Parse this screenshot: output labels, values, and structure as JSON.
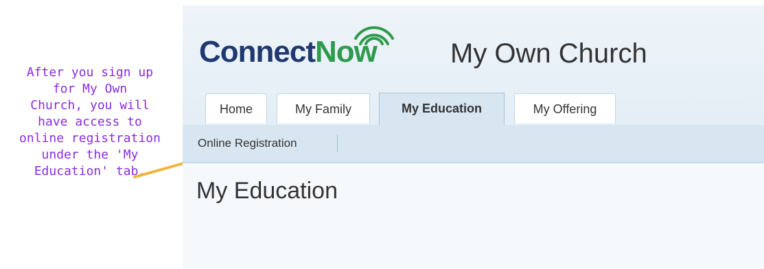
{
  "annotation": {
    "text": "After you sign up\nfor My Own\nChurch, you will\nhave access to\nonline registration\nunder the 'My\nEducation' tab."
  },
  "logo": {
    "text_connect": "Connect",
    "text_now": "Now"
  },
  "header": {
    "church_title": "My Own Church"
  },
  "tabs": [
    {
      "label": "Home",
      "active": false
    },
    {
      "label": "My Family",
      "active": false
    },
    {
      "label": "My Education",
      "active": true
    },
    {
      "label": "My Offering",
      "active": false
    }
  ],
  "subnav": {
    "items": [
      {
        "label": "Online Registration"
      }
    ]
  },
  "main": {
    "heading": "My Education"
  },
  "colors": {
    "annotation": "#8a2be2",
    "arrow": "#f0b53a",
    "logo_navy": "#20386f",
    "logo_green": "#2e9a4c",
    "active_tab_bg": "#d7e6f1"
  }
}
